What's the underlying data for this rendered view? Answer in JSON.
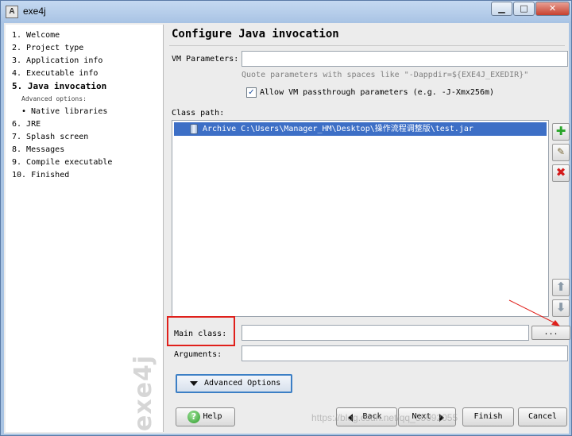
{
  "window": {
    "title": "exe4j",
    "app_icon": "A",
    "minimize_label": "▁",
    "maximize_label": "□",
    "close_label": "✕"
  },
  "nav": {
    "items": [
      {
        "label": "1.  Welcome"
      },
      {
        "label": "2.  Project type"
      },
      {
        "label": "3.  Application info"
      },
      {
        "label": "4.  Executable info"
      },
      {
        "label": "5.  Java invocation"
      },
      {
        "label": "Advanced options:"
      },
      {
        "label": "• Native libraries"
      },
      {
        "label": "6.  JRE"
      },
      {
        "label": "7.  Splash screen"
      },
      {
        "label": "8.  Messages"
      },
      {
        "label": "9.  Compile executable"
      },
      {
        "label": "10.  Finished"
      }
    ],
    "brand": "exe4j"
  },
  "main": {
    "heading": "Configure Java invocation",
    "vm_parameters": {
      "label": "VM Parameters:",
      "value": ""
    },
    "hint": "Quote parameters with spaces like \"-Dappdir=${EXE4J_EXEDIR}\"",
    "passthrough": {
      "checked": true,
      "check_glyph": "✓",
      "label": "Allow VM passthrough parameters (e.g. -J-Xmx256m)"
    },
    "classpath": {
      "label": "Class path:",
      "entries": [
        "Archive C:\\Users\\Manager_HM\\Desktop\\操作流程调整版\\test.jar"
      ]
    },
    "classpath_buttons": {
      "add": "✚",
      "edit": "✎",
      "remove": "✖",
      "up": "⬆",
      "down": "⬇"
    },
    "main_class": {
      "label": "Main class:",
      "value": "",
      "browse_label": "..."
    },
    "arguments": {
      "label": "Arguments:",
      "value": ""
    },
    "advanced_options_label": "Advanced Options"
  },
  "buttons": {
    "help": "Help",
    "help_glyph": "?",
    "back": "Back",
    "next": "Next",
    "finish": "Finish",
    "cancel": "Cancel"
  },
  "colors": {
    "selection": "#3d6fc6",
    "highlight_box": "#e0201b",
    "focus_border": "#3c7fc5"
  },
  "watermark": "https://blog.csdn.net/qq_35092055"
}
